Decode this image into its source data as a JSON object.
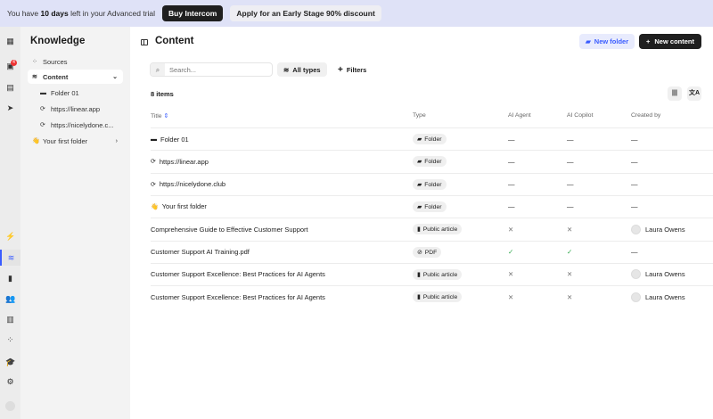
{
  "banner": {
    "pre": "You have ",
    "days": "10 days",
    "post": " left in your Advanced trial",
    "buy": "Buy Intercom",
    "discount": "Apply for an Early Stage 90% discount"
  },
  "rail": {
    "inbox_badge": "4"
  },
  "sidebar": {
    "title": "Knowledge",
    "sources": "Sources",
    "content": "Content",
    "items": [
      {
        "label": "Folder 01",
        "icon": "folder-icon"
      },
      {
        "label": "https://linear.app",
        "icon": "sync-icon"
      },
      {
        "label": "https://nicelydone.c...",
        "icon": "sync-icon"
      },
      {
        "label": "Your first folder",
        "icon": "wave-emoji"
      }
    ]
  },
  "main": {
    "title": "Content",
    "new_folder": "New folder",
    "new_content": "New content",
    "search_placeholder": "Search...",
    "all_types": "All types",
    "filters": "Filters",
    "count": "8 items",
    "columns": [
      "Title",
      "Type",
      "AI Agent",
      "AI Copilot",
      "Created by"
    ],
    "rows": [
      {
        "title": "Folder 01",
        "icon": "▬",
        "type": "Folder",
        "agent": "—",
        "copilot": "—",
        "by": "—"
      },
      {
        "title": "https://linear.app",
        "icon": "⟳",
        "type": "Folder",
        "agent": "—",
        "copilot": "—",
        "by": "—"
      },
      {
        "title": "https://nicelydone.club",
        "icon": "⟳",
        "type": "Folder",
        "agent": "—",
        "copilot": "—",
        "by": "—"
      },
      {
        "title": "Your first folder",
        "icon": "👋",
        "type": "Folder",
        "agent": "—",
        "copilot": "—",
        "by": "—"
      },
      {
        "title": "Comprehensive Guide to Effective Customer Support",
        "icon": "",
        "type": "Public article",
        "agent": "✕",
        "copilot": "✕",
        "by": "Laura Owens"
      },
      {
        "title": "Customer Support AI Training.pdf",
        "icon": "",
        "type": "PDF",
        "agent": "✓",
        "copilot": "✓",
        "by": "—"
      },
      {
        "title": "Customer Support Excellence: Best Practices for AI Agents",
        "icon": "",
        "type": "Public article",
        "agent": "✕",
        "copilot": "✕",
        "by": "Laura Owens"
      },
      {
        "title": "Customer Support Excellence: Best Practices for AI Agents",
        "icon": "",
        "type": "Public article",
        "agent": "✕",
        "copilot": "✕",
        "by": "Laura Owens"
      }
    ]
  }
}
